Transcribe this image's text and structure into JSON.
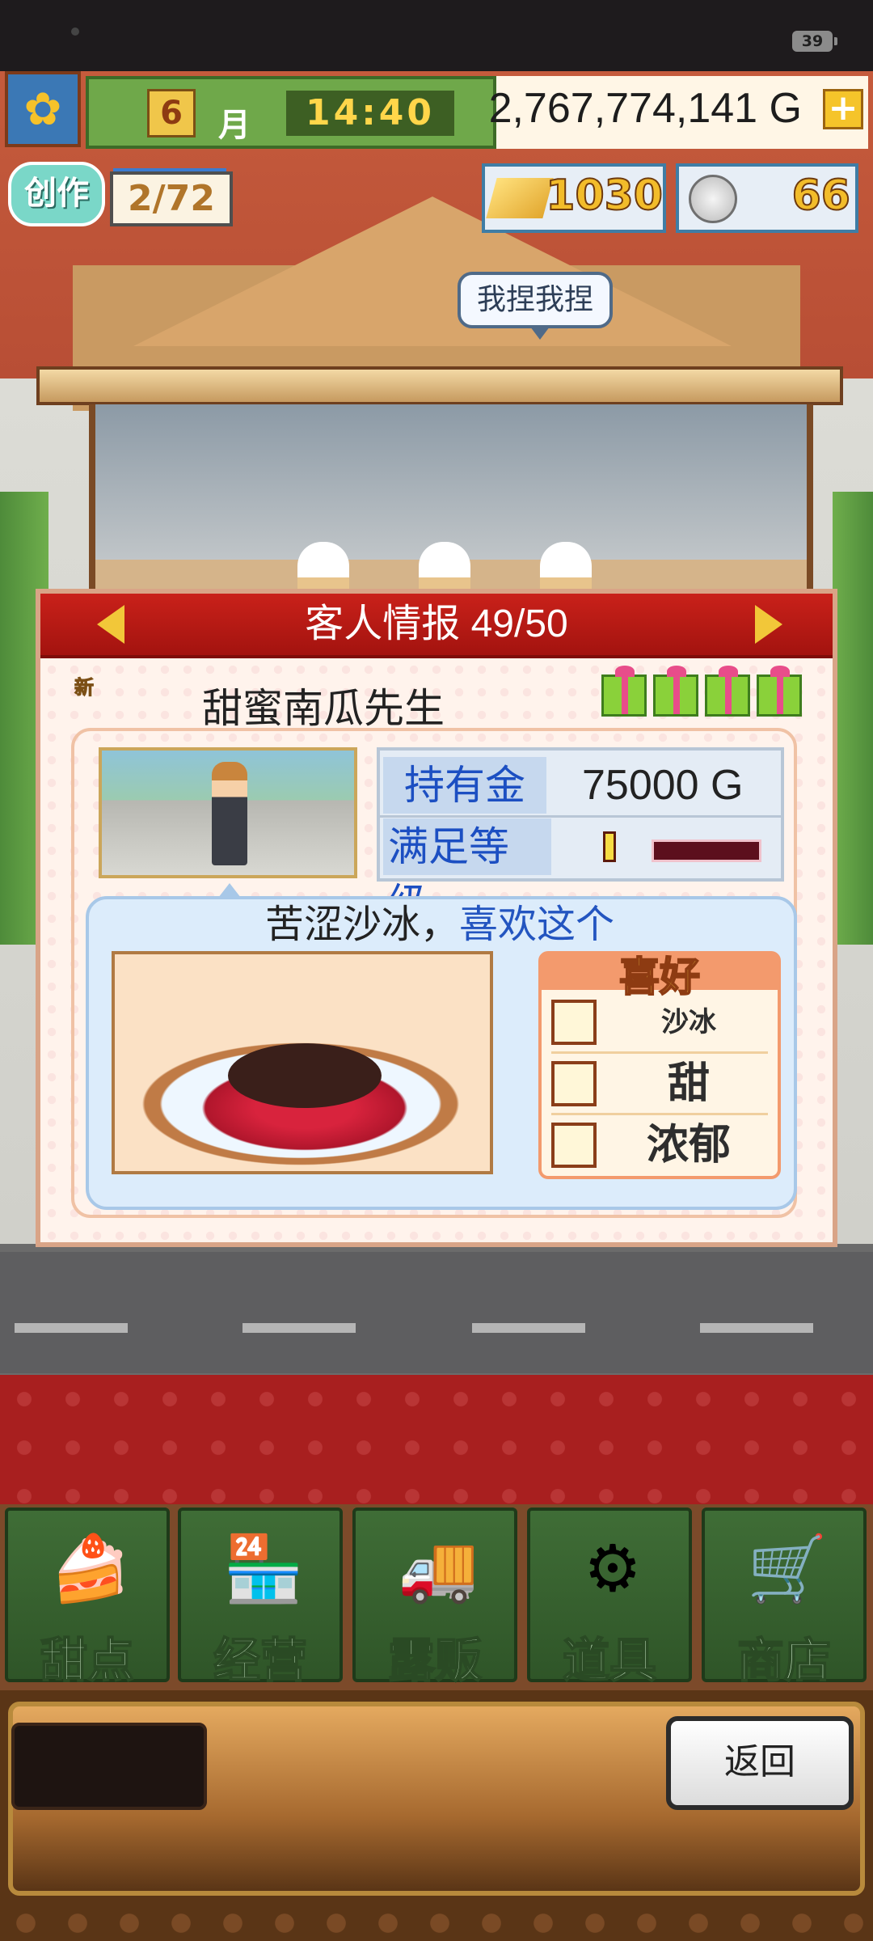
{
  "status_bar": {
    "battery": "39"
  },
  "hud": {
    "month": "6",
    "month_label": "月",
    "time": "14:40",
    "gold": "2,767,774,141 G",
    "plus": "+",
    "create_label": "创作",
    "create_count": "2/72",
    "gold_bars": "1030",
    "medals": "66"
  },
  "scene": {
    "speech_bubble": "我捏我捏"
  },
  "panel": {
    "title": "客人情报 49/50",
    "new_badge": "新",
    "customer_name": "甜蜜南瓜先生",
    "gift_count": 4,
    "stats": {
      "money_label": "持有金",
      "money_value": "75000 G",
      "satisfaction_label": "满足等级"
    },
    "description": {
      "main": "苦涩沙冰，",
      "like": "喜欢这个"
    },
    "preferences": {
      "title": "喜好",
      "items": [
        {
          "icon": "shaved-ice-icon",
          "label": "沙冰",
          "size": "small"
        },
        {
          "icon": "chocolate-icon",
          "label": "甜",
          "size": "large"
        },
        {
          "icon": "rich-flavor-icon",
          "label": "浓郁",
          "size": "large"
        }
      ]
    }
  },
  "nav": {
    "items": [
      {
        "icon": "cake-icon",
        "label": "甜点"
      },
      {
        "icon": "shop-building-icon",
        "label": "经营"
      },
      {
        "icon": "food-truck-icon",
        "label": "露贩"
      },
      {
        "icon": "gear-bag-icon",
        "label": "道具"
      },
      {
        "icon": "cart-icon",
        "label": "商店"
      }
    ]
  },
  "footer": {
    "return_label": "返回"
  },
  "colors": {
    "header_red": "#c9211a",
    "label_blue": "#1c4fc2",
    "gold_yellow": "#f2bc2a",
    "nav_green": "#3f6d36"
  }
}
